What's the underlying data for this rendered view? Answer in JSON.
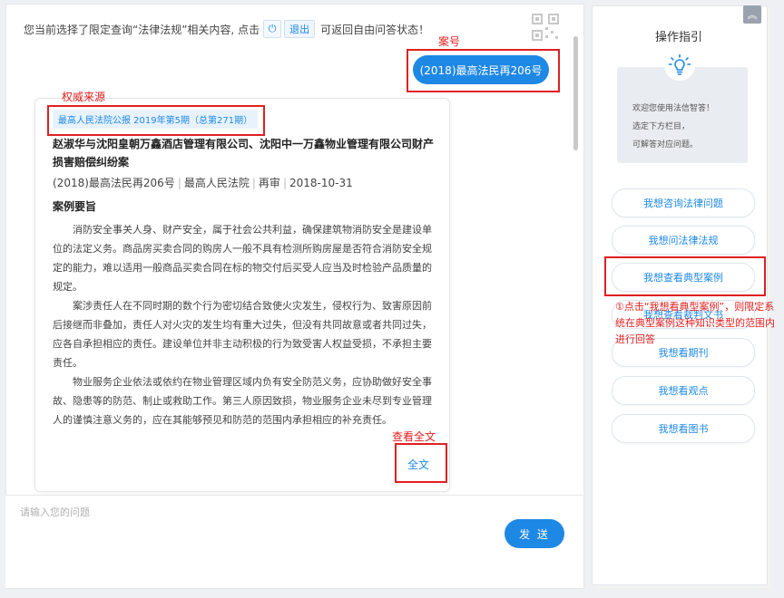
{
  "chat": {
    "notice_before": "您当前选择了限定查询“法律法规”相关内容, 点击",
    "exit_label": "退出",
    "notice_after": "可返回自由问答状态！",
    "case_pill": "(2018)最高法民再206号",
    "card": {
      "source_badge": "最高人民法院公报 2019年第5期（总第271期）",
      "title": "赵淑华与沈阳皇朝万鑫酒店管理有限公司、沈阳中一万鑫物业管理有限公司财产损害赔偿纠纷案",
      "meta": [
        "(2018)最高法民再206号",
        "最高人民法院",
        "再审",
        "2018-10-31"
      ],
      "section": "案例要旨",
      "paragraphs": [
        "消防安全事关人身、财产安全，属于社会公共利益，确保建筑物消防安全是建设单位的法定义务。商品房买卖合同的购房人一般不具有检测所购房屋是否符合消防安全规定的能力，难以适用一般商品买卖合同在标的物交付后买受人应当及时检验产品质量的规定。",
        "案涉责任人在不同时期的数个行为密切结合致使火灾发生，侵权行为、致害原因前后接继而非叠加，责任人对火灾的发生均有重大过失，但没有共同故意或者共同过失，应各自承担相应的责任。建设单位并非主动积极的行为致受害人权益受损，不承担主要责任。",
        "物业服务企业依法或依约在物业管理区域内负有安全防范义务，应协助做好安全事故、隐患等的防范、制止或救助工作。第三人原因致损，物业服务企业未尽到专业管理人的谨慎注意义务的，应在其能够预见和防范的范围内承担相应的补充责任。"
      ],
      "fulltext_label": "全文"
    },
    "input_placeholder": "请输入您的问题",
    "send_label": "发 送"
  },
  "sidebar": {
    "collapse_glyph": "︽",
    "title": "操作指引",
    "welcome_lines": [
      "欢迎您使用法信智答！",
      "选定下方栏目，",
      "可解答对应问题。"
    ],
    "options": [
      "我想咨询法律问题",
      "我想问法律法规",
      "我想查看典型案例",
      "我想查看裁判文书",
      "我想看期刊",
      "我想看观点",
      "我想看图书"
    ]
  },
  "annotations": {
    "case_number": "案号",
    "authority_source": "权威来源",
    "view_fulltext": "查看全文",
    "typical_case_note": "①点击“我想看典型案例”，则限定系统在典型案例这种知识类型的范围内进行回答"
  }
}
